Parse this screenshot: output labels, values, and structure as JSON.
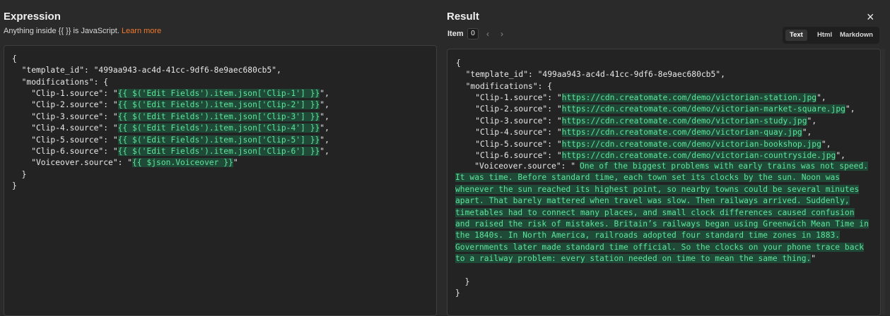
{
  "expression": {
    "title": "Expression",
    "hint": "Anything inside {{ }} is JavaScript.",
    "learn_more": "Learn more",
    "lines_before": "{\n  \"template_id\": \"499aa943-ac4d-41cc-9df6-8e9aec680cb5\",\n  \"modifications\": {",
    "clips": [
      {
        "key": "    \"Clip-1.source\": \"",
        "expr": "{{ $('Edit Fields').item.json['Clip-1'] }}",
        "tail": "\","
      },
      {
        "key": "    \"Clip-2.source\": \"",
        "expr": "{{ $('Edit Fields').item.json['Clip-2'] }}",
        "tail": "\","
      },
      {
        "key": "    \"Clip-3.source\": \"",
        "expr": "{{ $('Edit Fields').item.json['Clip-3'] }}",
        "tail": "\","
      },
      {
        "key": "    \"Clip-4.source\": \"",
        "expr": "{{ $('Edit Fields').item.json['Clip-4'] }}",
        "tail": "\","
      },
      {
        "key": "    \"Clip-5.source\": \"",
        "expr": "{{ $('Edit Fields').item.json['Clip-5'] }}",
        "tail": "\","
      },
      {
        "key": "    \"Clip-6.source\": \"",
        "expr": "{{ $('Edit Fields').item.json['Clip-6'] }}",
        "tail": "\","
      },
      {
        "key": "    \"Voiceover.source\": \"",
        "expr": "{{ $json.Voiceover }}",
        "tail": "\""
      }
    ],
    "lines_after": "  }\n}"
  },
  "result": {
    "title": "Result",
    "item_label": "Item",
    "item_value": "0",
    "prev": "‹",
    "next": "›",
    "tabs": [
      "Text",
      "Html",
      "Markdown"
    ],
    "active_tab": "Text",
    "lines_before": "{\n  \"template_id\": \"499aa943-ac4d-41cc-9df6-8e9aec680cb5\",\n  \"modifications\": {",
    "clips": [
      {
        "key": "    \"Clip-1.source\": \"",
        "val": "https://cdn.creatomate.com/demo/victorian-station.jpg",
        "tail": "\","
      },
      {
        "key": "    \"Clip-2.source\": \"",
        "val": "https://cdn.creatomate.com/demo/victorian-market-square.jpg",
        "tail": "\","
      },
      {
        "key": "    \"Clip-3.source\": \"",
        "val": "https://cdn.creatomate.com/demo/victorian-study.jpg",
        "tail": "\","
      },
      {
        "key": "    \"Clip-4.source\": \"",
        "val": "https://cdn.creatomate.com/demo/victorian-quay.jpg",
        "tail": "\","
      },
      {
        "key": "    \"Clip-5.source\": \"",
        "val": "https://cdn.creatomate.com/demo/victorian-bookshop.jpg",
        "tail": "\","
      },
      {
        "key": "    \"Clip-6.source\": \"",
        "val": "https://cdn.creatomate.com/demo/victorian-countryside.jpg",
        "tail": "\","
      }
    ],
    "voiceover_key": "    \"Voiceover.source\": \"",
    "voiceover_text": "One of the biggest problems with early trains was not speed. It was time. Before standard time, each town set its clocks by the sun. Noon was whenever the sun reached its highest point, so nearby towns could be several minutes apart. That barely mattered when travel was slow. Then railways arrived. Suddenly, timetables had to connect many places, and small clock differences caused confusion and raised the risk of mistakes. Britain’s railways began using Greenwich Mean Time in the 1840s. In North America, railroads adopted four standard time zones in 1883. Governments later made standard time official. So the clocks on your phone trace back to a railway problem: every station needed on time to mean the same thing.",
    "voiceover_tail": "\"",
    "lines_after": "  }\n}"
  },
  "close_icon": "×"
}
